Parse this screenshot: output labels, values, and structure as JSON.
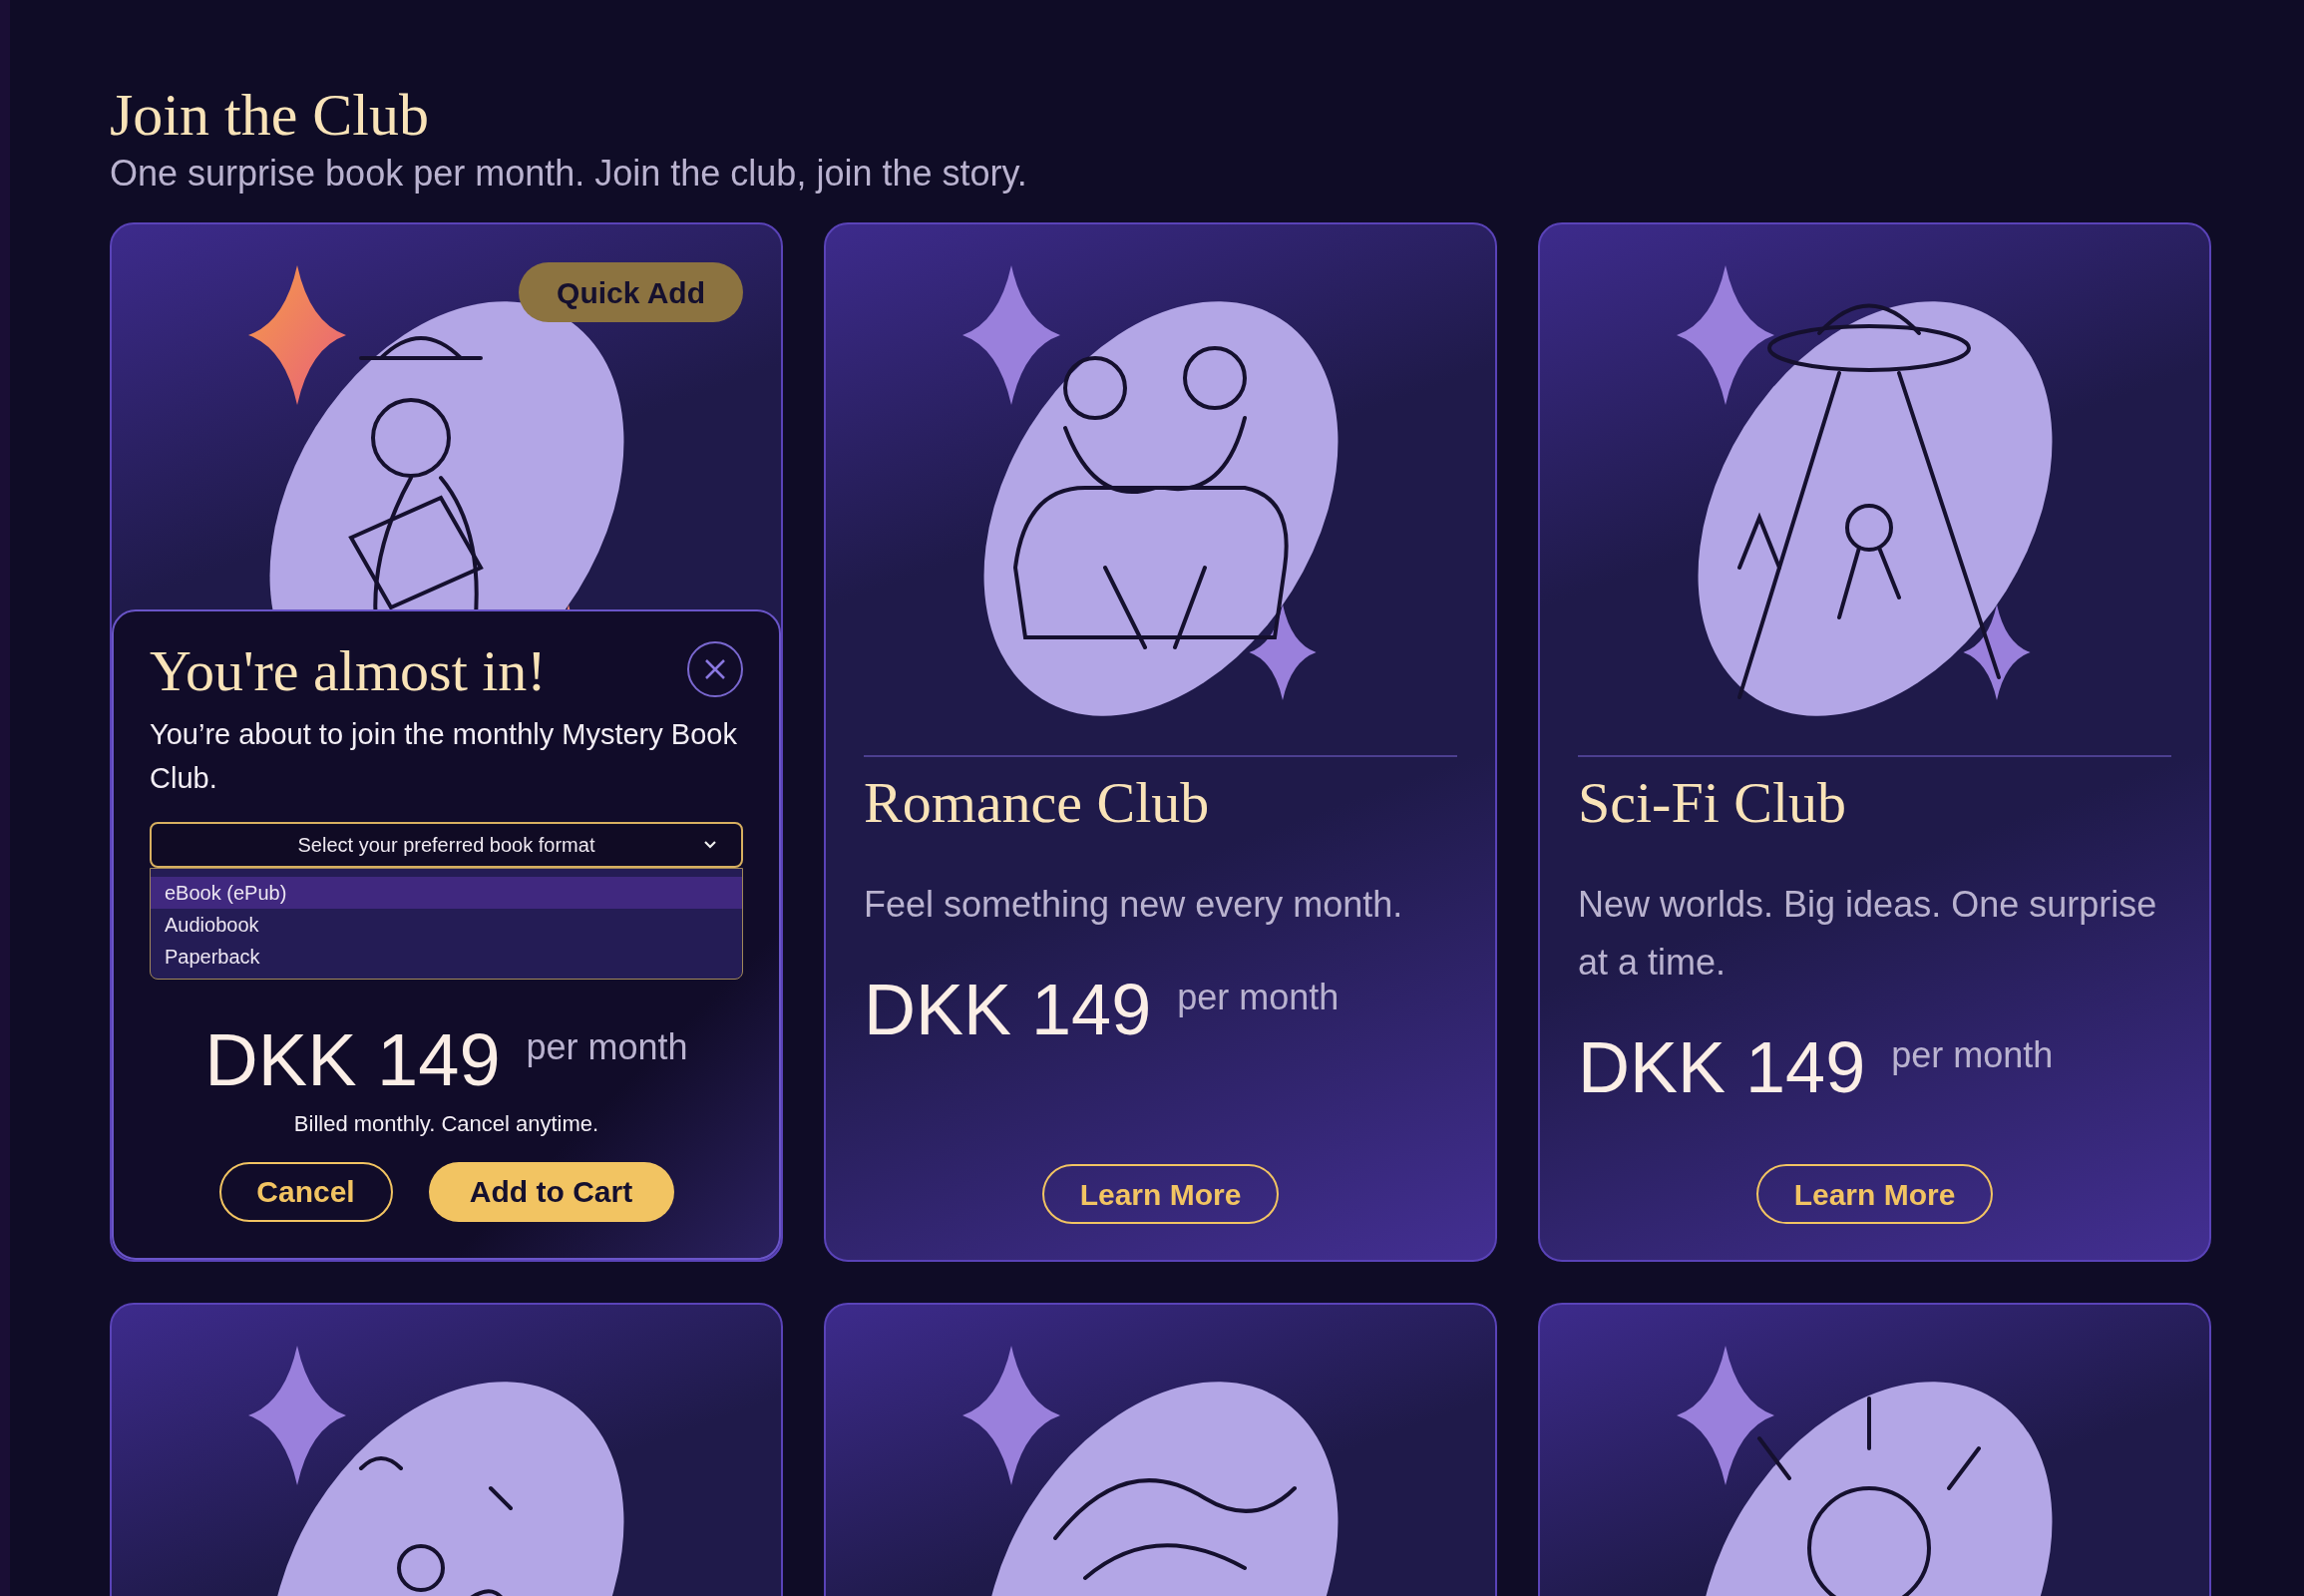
{
  "header": {
    "title": "Join the Club",
    "subtitle": "One surprise book per month. Join the club, join the story."
  },
  "cards": [
    {
      "badge": "Quick Add",
      "dialog": {
        "title": "You're almost in!",
        "message": "You’re about to join the monthly Mystery Book Club.",
        "select": {
          "placeholder": "Select your preferred book format",
          "options": [
            {
              "label": "eBook (ePub)",
              "selected": true
            },
            {
              "label": "Audiobook",
              "selected": false
            },
            {
              "label": "Paperback",
              "selected": false
            }
          ]
        },
        "price": "DKK 149",
        "period": "per month",
        "note": "Billed monthly. Cancel anytime.",
        "buttons": [
          {
            "label": "Cancel",
            "kind": "outline"
          },
          {
            "label": "Add to Cart",
            "kind": "primary"
          }
        ]
      }
    },
    {
      "title": "Romance Club",
      "description": "Feel something new every month.",
      "price": "DKK 149",
      "period": "per month",
      "button": "Learn More"
    },
    {
      "title": "Sci-Fi Club",
      "description": "New worlds. Big ideas. One surprise at a time.",
      "price": "DKK 149",
      "period": "per month",
      "button": "Learn More"
    }
  ]
}
